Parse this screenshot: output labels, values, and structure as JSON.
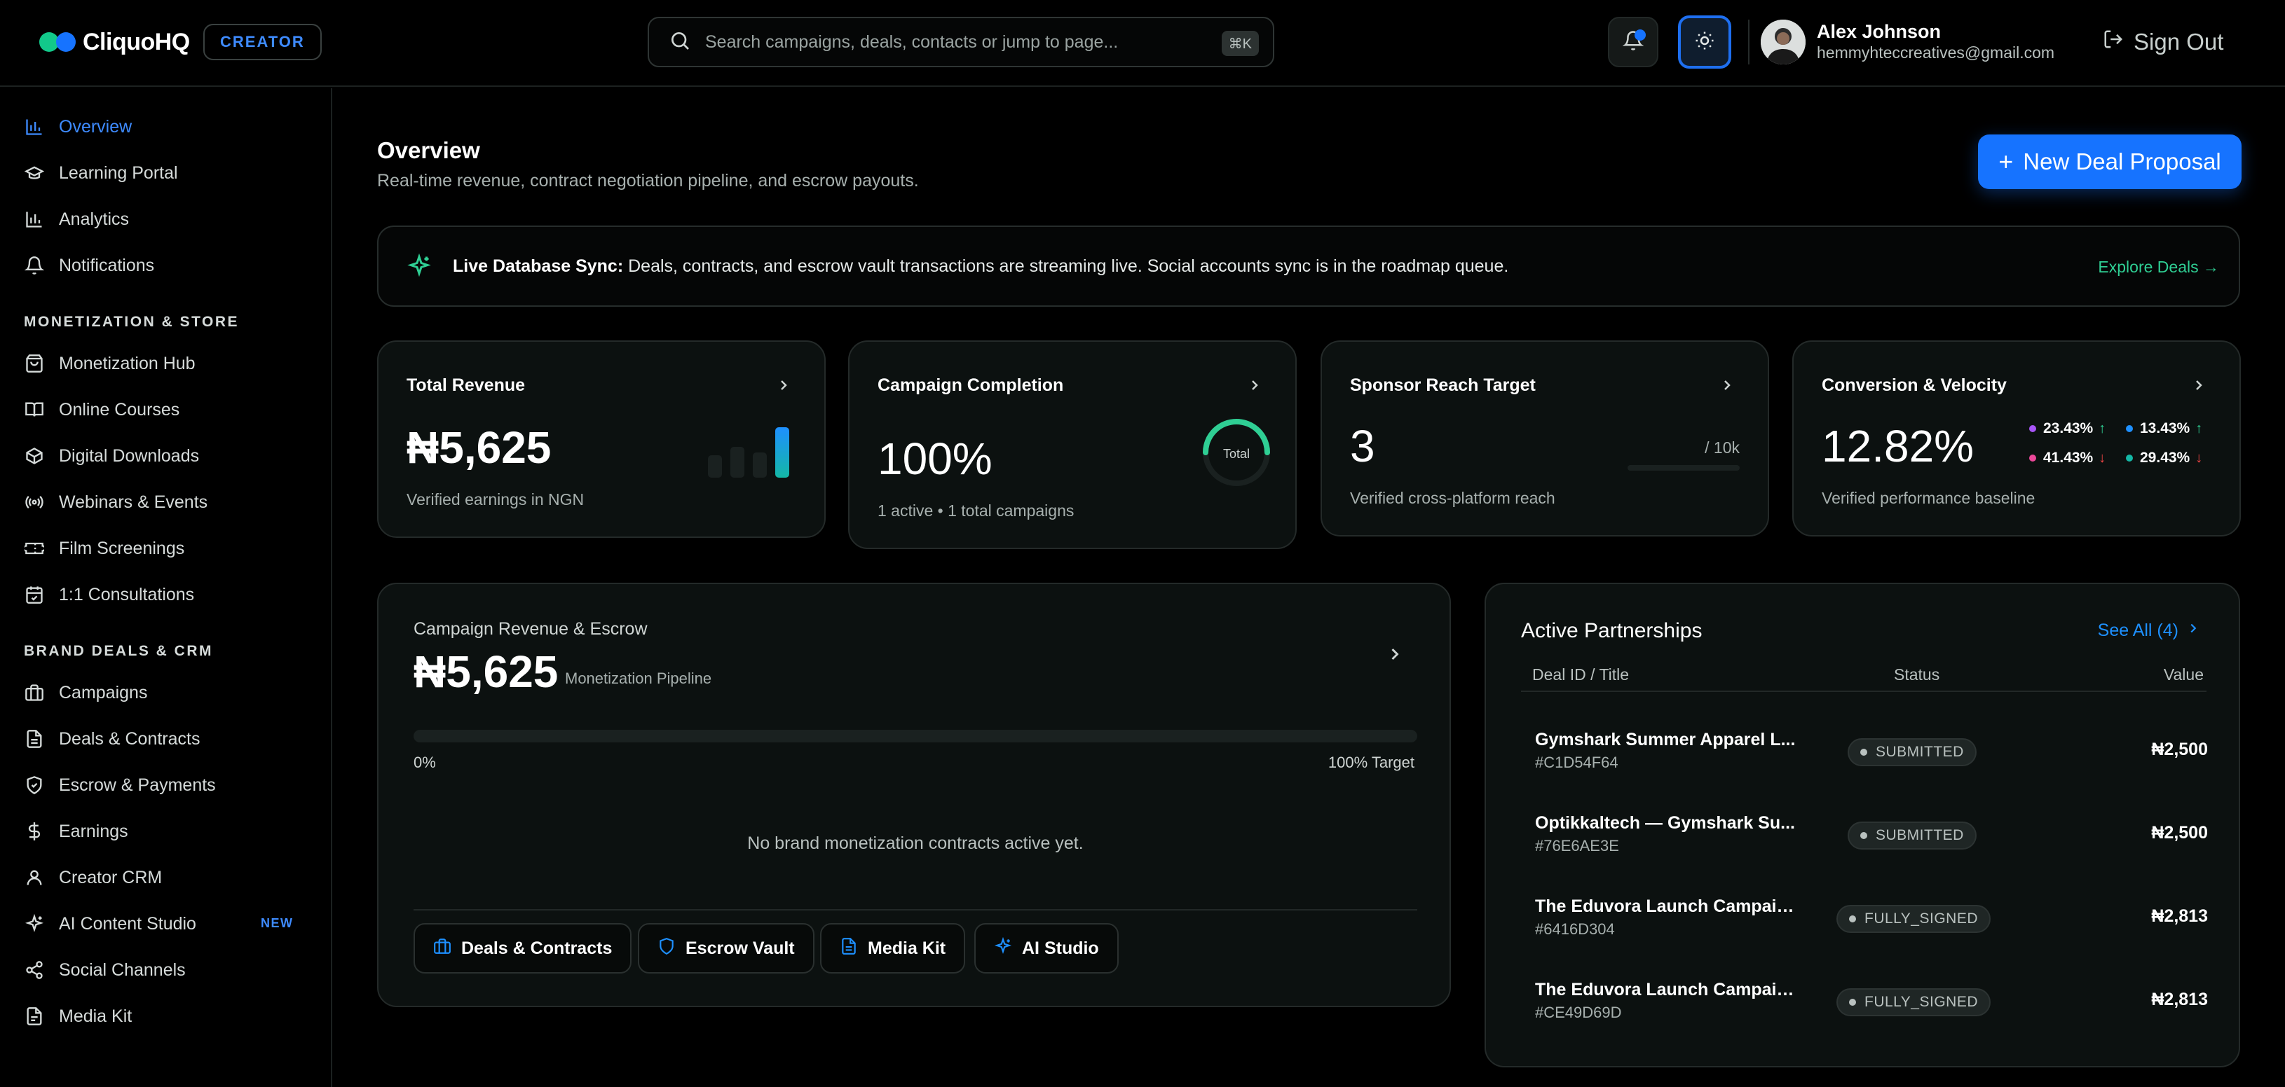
{
  "app": {
    "name": "CliquoHQ",
    "role_badge": "CREATOR"
  },
  "header": {
    "search_placeholder": "Search campaigns, deals, contacts or jump to page...",
    "search_shortcut": "⌘K",
    "user_name": "Alex Johnson",
    "user_email": "hemmyhteccreatives@gmail.com",
    "sign_out_label": "Sign Out"
  },
  "sidebar": {
    "main_items": [
      {
        "label": "Overview",
        "icon": "bar-chart-icon",
        "active": true
      },
      {
        "label": "Learning Portal",
        "icon": "graduation-cap-icon"
      },
      {
        "label": "Analytics",
        "icon": "bar-chart-icon"
      },
      {
        "label": "Notifications",
        "icon": "bell-icon"
      }
    ],
    "section_monetization": "MONETIZATION & STORE",
    "monetization_items": [
      {
        "label": "Monetization Hub",
        "icon": "shopping-bag-icon"
      },
      {
        "label": "Online Courses",
        "icon": "book-open-icon"
      },
      {
        "label": "Digital Downloads",
        "icon": "package-icon"
      },
      {
        "label": "Webinars & Events",
        "icon": "broadcast-icon"
      },
      {
        "label": "Film Screenings",
        "icon": "ticket-icon"
      },
      {
        "label": "1:1 Consultations",
        "icon": "calendar-check-icon"
      }
    ],
    "section_brand": "BRAND DEALS & CRM",
    "brand_items": [
      {
        "label": "Campaigns",
        "icon": "briefcase-icon"
      },
      {
        "label": "Deals & Contracts",
        "icon": "file-text-icon"
      },
      {
        "label": "Escrow & Payments",
        "icon": "shield-check-icon"
      },
      {
        "label": "Earnings",
        "icon": "dollar-sign-icon"
      },
      {
        "label": "Creator CRM",
        "icon": "user-icon"
      },
      {
        "label": "AI Content Studio",
        "icon": "sparkles-icon",
        "badge": "NEW"
      },
      {
        "label": "Social Channels",
        "icon": "share-icon"
      },
      {
        "label": "Media Kit",
        "icon": "file-icon"
      }
    ]
  },
  "page": {
    "title": "Overview",
    "subtitle": "Real-time revenue, contract negotiation pipeline, and escrow payouts.",
    "new_deal_label": "New Deal Proposal"
  },
  "sync_banner": {
    "label": "Live Database Sync:",
    "text": " Deals, contracts, and escrow vault transactions are streaming live. Social accounts sync is in the roadmap queue.",
    "link": "Explore Deals →"
  },
  "stats": {
    "revenue": {
      "title": "Total Revenue",
      "value": "₦5,625",
      "sub": "Verified earnings in NGN"
    },
    "completion": {
      "title": "Campaign Completion",
      "value": "100%",
      "sub": "1 active • 1 total campaigns",
      "gauge_label": "Total",
      "gauge_fraction": 1.0
    },
    "reach": {
      "title": "Sponsor Reach Target",
      "value": "3",
      "target": "/ 10k",
      "sub": "Verified cross-platform reach",
      "progress_fraction": 0.0003
    },
    "conversion": {
      "title": "Conversion & Velocity",
      "value": "12.82%",
      "sub": "Verified performance baseline",
      "metrics": [
        {
          "value": "23.43%",
          "dot_color": "#a855f7",
          "trend": "up"
        },
        {
          "value": "13.43%",
          "dot_color": "#1e90ff",
          "trend": "up"
        },
        {
          "value": "41.43%",
          "dot_color": "#ec4899",
          "trend": "down"
        },
        {
          "value": "29.43%",
          "dot_color": "#14b8a6",
          "trend": "down"
        }
      ]
    }
  },
  "revenue_panel": {
    "title": "Campaign Revenue & Escrow",
    "value": "₦5,625",
    "value_caption": "Monetization Pipeline",
    "progress_fraction": 0.0,
    "progress_start": "0%",
    "progress_end": "100% Target",
    "empty_text": "No brand monetization contracts active yet.",
    "actions": [
      {
        "label": "Deals & Contracts",
        "icon": "briefcase-icon"
      },
      {
        "label": "Escrow Vault",
        "icon": "shield-icon"
      },
      {
        "label": "Media Kit",
        "icon": "file-text-icon"
      },
      {
        "label": "AI Studio",
        "icon": "sparkles-icon"
      }
    ]
  },
  "partnerships": {
    "title": "Active Partnerships",
    "see_all": "See All (4)",
    "columns": [
      "Deal ID / Title",
      "Status",
      "Value"
    ],
    "rows": [
      {
        "title": "Gymshark Summer Apparel L...",
        "id": "#C1D54F64",
        "status": "SUBMITTED",
        "value": "₦2,500"
      },
      {
        "title": "Optikkaltech — Gymshark Su...",
        "id": "#76E6AE3E",
        "status": "SUBMITTED",
        "value": "₦2,500"
      },
      {
        "title": "The Eduvora Launch Campaig...",
        "id": "#6416D304",
        "status": "FULLY_SIGNED",
        "value": "₦2,813"
      },
      {
        "title": "The Eduvora Launch Campaig...",
        "id": "#CE49D69D",
        "status": "FULLY_SIGNED",
        "value": "₦2,813"
      }
    ]
  },
  "colors": {
    "accent_blue": "#1673ff",
    "accent_green": "#2fcf94",
    "card_bg": "#0c1110"
  }
}
